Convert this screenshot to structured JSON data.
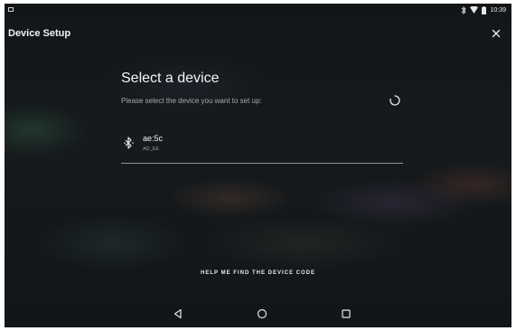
{
  "status_bar": {
    "time": "10:39",
    "icons": [
      "notification-icon",
      "bluetooth-icon",
      "wifi-icon",
      "battery-icon"
    ]
  },
  "app_bar": {
    "title": "Device Setup",
    "close_icon": "close-icon"
  },
  "content": {
    "heading": "Select a device",
    "subheading": "Please select the device you want to set up:",
    "spinner_icon": "loading-spinner-icon",
    "devices": [
      {
        "name": "ae:5c",
        "subtitle": "AD_EE",
        "icon": "bluetooth-icon"
      }
    ]
  },
  "help_link": "HELP ME FIND THE DEVICE CODE",
  "nav_bar": {
    "back_icon": "back-triangle-icon",
    "home_icon": "home-circle-icon",
    "recent_icon": "recent-apps-square-icon"
  },
  "colors": {
    "background": "#14181a",
    "text_primary": "#f2f2f2",
    "text_secondary": "#a6a8aa",
    "divider": "#8f9396"
  }
}
